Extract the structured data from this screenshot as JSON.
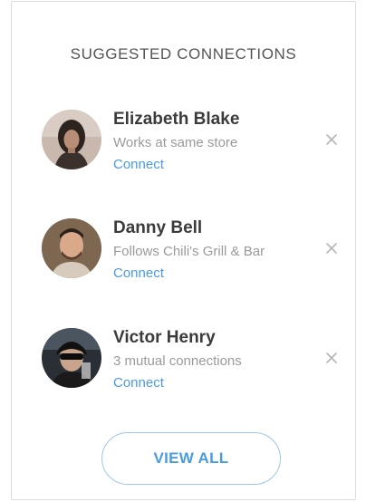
{
  "panel": {
    "title": "SUGGESTED CONNECTIONS",
    "view_all_label": "VIEW ALL"
  },
  "connections": [
    {
      "name": "Elizabeth Blake",
      "detail": "Works at same store",
      "action": "Connect",
      "dismiss_icon": "close-icon"
    },
    {
      "name": "Danny Bell",
      "detail": "Follows Chili's Grill & Bar",
      "action": "Connect",
      "dismiss_icon": "close-icon"
    },
    {
      "name": "Victor Henry",
      "detail": "3 mutual connections",
      "action": "Connect",
      "dismiss_icon": "close-icon"
    }
  ],
  "colors": {
    "accent": "#4a9be0",
    "muted_text": "#9a9a9a",
    "name_text": "#3b3b3b",
    "border": "#dcdcdc"
  }
}
